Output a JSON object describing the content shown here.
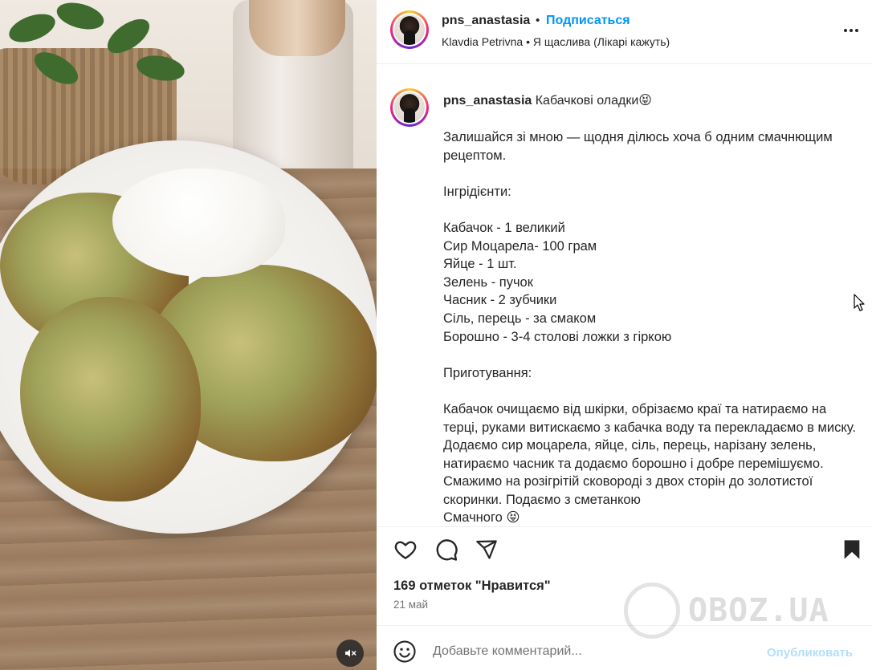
{
  "header": {
    "username": "pns_anastasia",
    "separator": "•",
    "follow_label": "Подписаться",
    "subtitle_user": "Klavdia Petrivna",
    "subtitle_separator": "•",
    "subtitle_track": "Я щаслива (Лікарі кажуть)"
  },
  "caption": {
    "username": "pns_anastasia",
    "title": "Кабачкові оладки",
    "title_emoji": "😝",
    "body": "Залишайся зі мною — щодня ділюсь хоча б одним смачнющим рецептом.\n\nІнгрідієнти:\n\nКабачок - 1 великий\nСир Моцарела- 100 грам\nЯйце - 1 шт.\nЗелень - пучок\nЧасник - 2 зубчики\nСіль, перець - за смаком\nБорошно - 3-4 столові ложки з гіркою\n\nПриготування:\n\nКабачок очищаємо від шкірки, обрізаємо краї та натираємо на терці, руками витискаємо з кабачка воду та перекладаємо в миску. Додаємо сир моцарела, яйце, сіль, перець, нарізану зелень, натираємо часник та додаємо борошно і добре перемішуємо. Смажимо на розігрітій сковороді з двох сторін до золотистої скоринки. Подаємо з сметанкою\nСмачного 😝"
  },
  "actions": {
    "likes": "169 отметок \"Нравится\"",
    "date": "21 май"
  },
  "comment": {
    "placeholder": "Добавьте комментарий...",
    "post_label": "Опубликовать"
  },
  "watermark": {
    "text": "OBOZ.UA"
  },
  "icons": {
    "like": "heart-icon",
    "comment": "comment-icon",
    "share": "send-icon",
    "save": "bookmark-icon",
    "more": "more-icon",
    "emoji": "emoji-icon",
    "mute": "volume-off-icon"
  },
  "colors": {
    "accent": "#0095f6",
    "post_disabled": "#b2dffc",
    "text": "#262626",
    "muted": "#737373"
  }
}
